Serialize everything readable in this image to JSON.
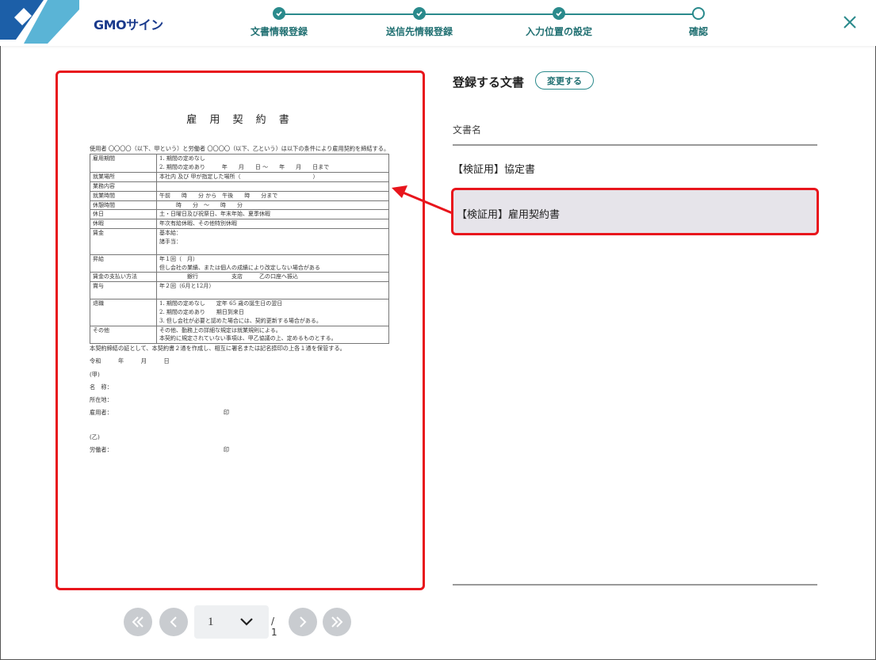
{
  "header": {
    "brand": "GMOサイン",
    "steps": [
      {
        "label": "文書情報登録",
        "status": "done"
      },
      {
        "label": "送信先情報登録",
        "status": "done"
      },
      {
        "label": "入力位置の設定",
        "status": "done"
      },
      {
        "label": "確認",
        "status": "current"
      }
    ],
    "close_icon": "close-icon"
  },
  "colors": {
    "accent": "#2a8a8c",
    "highlight": "#e8151c",
    "selected_row": "#e6e4ea"
  },
  "document": {
    "title": "雇 用 契 約 書",
    "intro": "使用者 〇〇〇〇（以下、甲という）と労働者 〇〇〇〇（以下、乙という）は以下の条件により雇用契約を締結する。",
    "rows": [
      {
        "key": "雇用期間",
        "lines": [
          "1. 期間の定めなし",
          "2. 期間の定めあり　　　年　　月　　日 ～　　年　　月　　日まで"
        ]
      },
      {
        "key": "就業場所",
        "lines": [
          "本社内 及び 甲が指定した場所（　　　　　　　　　　　　　）"
        ]
      },
      {
        "key": "業務内容",
        "lines": [
          ""
        ]
      },
      {
        "key": "就業時間",
        "lines": [
          "午前　　時　　分 から　午後　　時　　分まで"
        ]
      },
      {
        "key": "休憩時間",
        "lines": [
          "　　　時　　分　～　　時　　分"
        ]
      },
      {
        "key": "休日",
        "lines": [
          "土・日曜日及び祝祭日、年末年始、夏季休暇"
        ]
      },
      {
        "key": "休暇",
        "lines": [
          "年次有給休暇、その他特別休暇"
        ]
      },
      {
        "key": "賃金",
        "lines": [
          "基本給：",
          "諸手当：",
          ""
        ]
      },
      {
        "key": "昇給",
        "lines": [
          "年１回（　月）",
          "但し会社の業績、または個人の成績により改定しない場合がある"
        ]
      },
      {
        "key": "賃金の支払い方法",
        "lines": [
          "　　　　　銀行　　　　　　支店　　　乙の口座へ振込"
        ]
      },
      {
        "key": "賞与",
        "lines": [
          "年２回（6月と12月）",
          ""
        ]
      },
      {
        "key": "退職",
        "lines": [
          "1. 期間の定めなし　　定年 65 歳の誕生日の翌日",
          "2. 期間の定めあり　　期日到来日",
          "3. 但し会社が必要と認めた場合には、契約更新する場合がある。"
        ]
      },
      {
        "key": "その他",
        "lines": [
          "その他、勤務上の詳細な規定は就業規則による。",
          "本契約に規定されていない事項は、甲乙協議の上、定めるものとする。"
        ]
      }
    ],
    "after": [
      "本契約締結の証として、本契約書２通を作成し、相互に署名または記名捺印の上各１通を保管する。",
      "令和　　　年　　　月　　　日",
      "(甲)",
      "名　称：",
      "所在地：",
      "雇用者：　　　　　　　　　　　　　　　　　　　　印",
      "",
      "(乙)",
      "労働者：　　　　　　　　　　　　　　　　　　　　印"
    ]
  },
  "pager": {
    "current": "1",
    "total": "/ 1"
  },
  "panel": {
    "title": "登録する文書",
    "change_label": "変更する",
    "column_header": "文書名",
    "documents": [
      {
        "name": "【検証用】協定書",
        "selected": false
      },
      {
        "name": "【検証用】雇用契約書",
        "selected": true
      }
    ]
  }
}
